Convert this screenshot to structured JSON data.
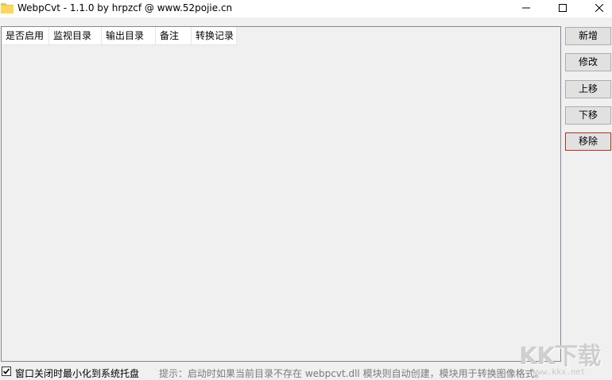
{
  "window": {
    "title": "WebpCvt - 1.1.0 by hrpzcf @ www.52pojie.cn",
    "icon": "folder-icon"
  },
  "list": {
    "columns": [
      "是否启用",
      "监视目录",
      "输出目录",
      "备注",
      "转换记录"
    ],
    "rows": []
  },
  "buttons": {
    "add": "新增",
    "edit": "修改",
    "move_up": "上移",
    "move_down": "下移",
    "remove": "移除"
  },
  "footer": {
    "minimize_to_tray_label": "窗口关闭时最小化到系统托盘",
    "minimize_to_tray_checked": true,
    "hint": "提示：启动时如果当前目录不存在 webpcvt.dll 模块则自动创建，模块用于转换图像格式。"
  },
  "watermark": {
    "brand": "KK下载",
    "url": "www.kkx.net"
  },
  "colors": {
    "focus_border": "#c42b1c",
    "folder": "#f5c542"
  }
}
